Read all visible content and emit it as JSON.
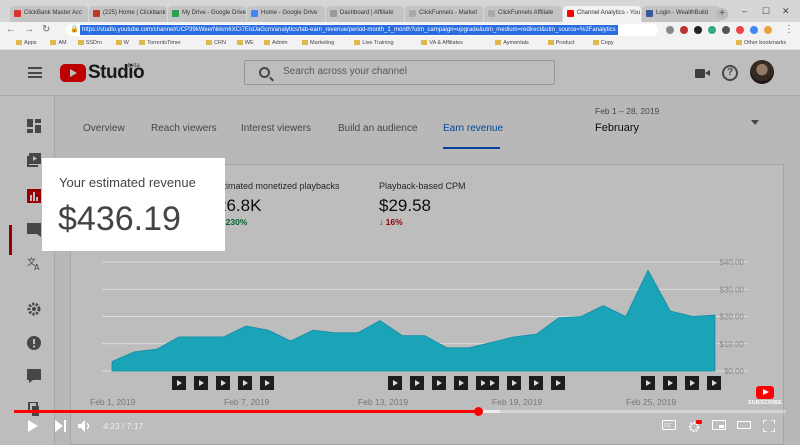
{
  "browser": {
    "tabs": [
      {
        "label": "ClickBank Master Acc",
        "fav": "#d33"
      },
      {
        "label": "(225) Home | Clickbank",
        "fav": "#c0392b"
      },
      {
        "label": "My Drive - Google Drive",
        "fav": "#2e9e48"
      },
      {
        "label": "Home - Google Drive",
        "fav": "#4285f4"
      },
      {
        "label": "Dashboard | Affiliate",
        "fav": "#999"
      },
      {
        "label": "ClickFunnels - Market",
        "fav": "#aaa"
      },
      {
        "label": "ClickFunnels Affiliate",
        "fav": "#aaa"
      },
      {
        "label": "Channel Analytics - You",
        "fav": "#ff0000"
      },
      {
        "label": "Login - WealthBuild",
        "fav": "#3b5998"
      }
    ],
    "active_tab": 7,
    "url": "https://studio.youtube.com/channel/UCP39kWeerNkkm6XCI7EIdJaGcm/analytics/tab-earn_revenue/period-month_1_month?utm_campaign=upgrade&utm_medium=redirect&utm_source=%2Fanalytics",
    "bookmarks": [
      "Apps",
      "AM",
      "SSDrn",
      "W",
      "TorrentsTimer",
      "CRN",
      "WE",
      "Admin",
      "Marketing",
      "Live Training",
      "VA & Affiliates",
      "Aymentals",
      "Product",
      "Copy"
    ],
    "other_bookmarks": "Other bookmarks"
  },
  "studio": {
    "logo_text": "Studio",
    "logo_badge": "beta",
    "search_placeholder": "Search across your channel",
    "tabs": [
      {
        "label": "Overview"
      },
      {
        "label": "Reach viewers"
      },
      {
        "label": "Interest viewers"
      },
      {
        "label": "Build an audience"
      },
      {
        "label": "Earn revenue"
      }
    ],
    "date_range": "Feb 1 – 28, 2019",
    "date_label": "February",
    "metrics": [
      {
        "label": "Your estimated revenue",
        "value": "$436.19"
      },
      {
        "label": "stimated monetized playbacks",
        "value": "26.8K",
        "delta": "230%",
        "direction": "up",
        "color": "#0b8043"
      },
      {
        "label": "Playback-based CPM",
        "value": "$29.58",
        "delta": "16%",
        "direction": "down",
        "color": "#c00"
      }
    ]
  },
  "chart_data": {
    "type": "area",
    "title": "",
    "xlabel": "",
    "ylabel": "",
    "x_tick_labels": [
      "Feb 1, 2019",
      "Feb 7, 2019",
      "Feb 13, 2019",
      "Feb 19, 2019",
      "Feb 25, 2019"
    ],
    "y_tick_labels": [
      "$0.00",
      "$10.00",
      "$20.00",
      "$30.00",
      "$40.00"
    ],
    "ylim": [
      0,
      40
    ],
    "series": [
      {
        "color": "#1ba3b8",
        "x": [
          1,
          2,
          3,
          4,
          5,
          6,
          7,
          8,
          9,
          10,
          11,
          12,
          13,
          14,
          15,
          16,
          17,
          18,
          19,
          20,
          21,
          22,
          23,
          24,
          25,
          26,
          27,
          28
        ],
        "values": [
          3.5,
          7,
          8,
          12.5,
          12.5,
          12.5,
          16.5,
          15,
          11,
          15,
          14,
          14,
          18.5,
          13,
          13,
          8.5,
          8.5,
          10.5,
          12.5,
          13.5,
          19.5,
          20,
          24,
          20,
          37,
          22,
          20,
          20.5
        ]
      }
    ],
    "grid": true,
    "legend": "none"
  },
  "player": {
    "time": "4:23 / 7:17",
    "progress_fraction": 0.602,
    "buffer_fraction": 0.63,
    "subscribe_label": "SUBSCRIBE"
  }
}
